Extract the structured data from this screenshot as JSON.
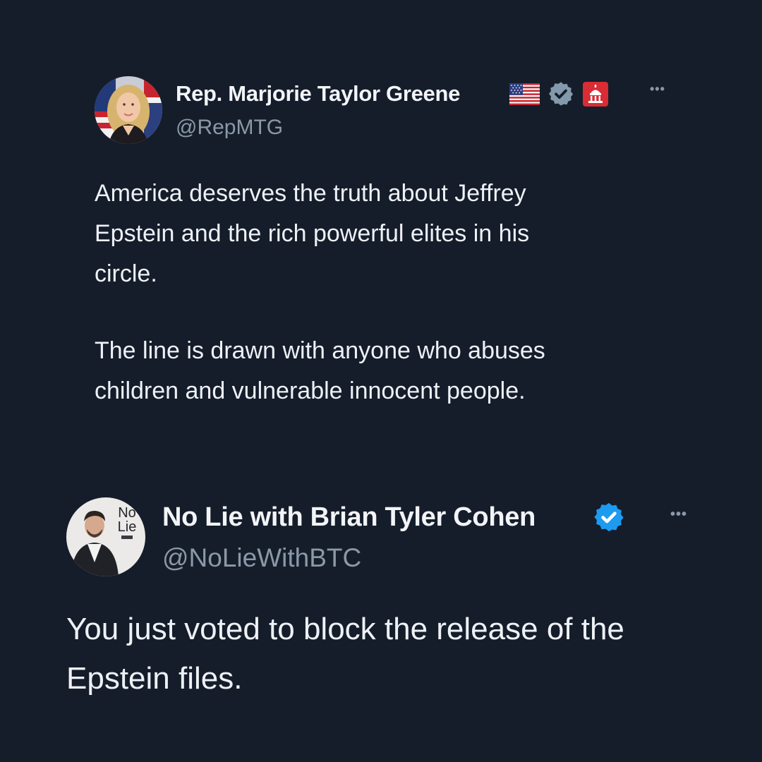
{
  "tweets": [
    {
      "display_name": "Rep. Marjorie Taylor Greene",
      "handle": "@RepMTG",
      "verified_badge": "gray-check-icon",
      "flag_icon": "us-flag-icon",
      "affiliation_icon": "capitol-icon",
      "more_label": "•••",
      "paragraphs": [
        "America deserves the truth about Jeffrey\nEpstein and the rich powerful elites in his\ncircle.",
        "The line is drawn with anyone who abuses\nchildren and vulnerable innocent people."
      ]
    },
    {
      "display_name": "No Lie with Brian Tyler Cohen",
      "handle": "@NoLieWithBTC",
      "verified_badge": "blue-check-icon",
      "avatar_text": [
        "No",
        "Lie"
      ],
      "more_label": "•••",
      "paragraphs": [
        "You just voted to block the release of the\nEpstein files."
      ]
    }
  ],
  "colors": {
    "background": "#151d2b",
    "text_primary": "#eef1f5",
    "text_secondary": "#8b98a8",
    "verified_blue": "#1d9bf0",
    "verified_gray": "#829aab",
    "affiliation_red": "#d92c35"
  }
}
